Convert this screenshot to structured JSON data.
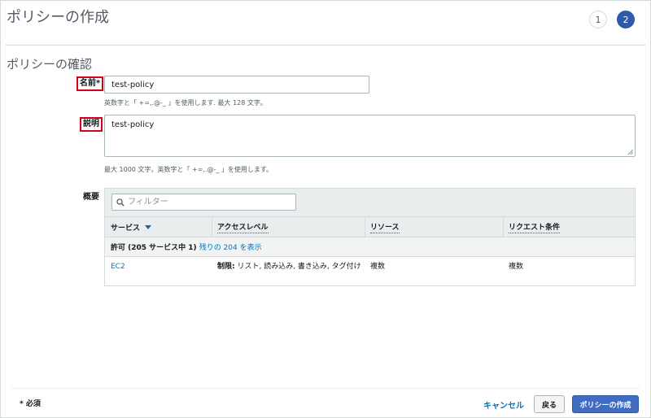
{
  "header": {
    "title": "ポリシーの作成",
    "steps": [
      "1",
      "2"
    ],
    "active_step": "2"
  },
  "review": {
    "section_title": "ポリシーの確認",
    "name_label": "名前*",
    "name_value": "test-policy",
    "name_hint": "英数字と「 +=,.@-_ 」を使用します. 最大 128 文字。",
    "description_label": "説明",
    "description_value": "test-policy",
    "description_hint": "最大 1000 文字。英数字と「 +=,.@-_ 」を使用します。",
    "summary_label": "概要"
  },
  "summary": {
    "filter_placeholder": "フィルター",
    "columns": [
      "サービス",
      "アクセスレベル",
      "リソース",
      "リクエスト条件"
    ],
    "group_text": "許可 (205 サービス中 1)",
    "group_link": "残りの 204 を表示",
    "rows": [
      {
        "service": "EC2",
        "access_bold": "制限:",
        "access_rest": " リスト, 読み込み, 書き込み, タグ付け",
        "resource": "複数",
        "condition": "複数"
      }
    ]
  },
  "footer": {
    "required_note": "* 必須",
    "cancel_label": "キャンセル",
    "back_label": "戻る",
    "create_label": "ポリシーの作成"
  },
  "colors": {
    "accent": "#2f5aa8",
    "link": "#0073bb",
    "highlight": "#d0021b"
  },
  "icons": [
    "search-icon",
    "sort-caret-icon",
    "resize-grip-icon"
  ]
}
